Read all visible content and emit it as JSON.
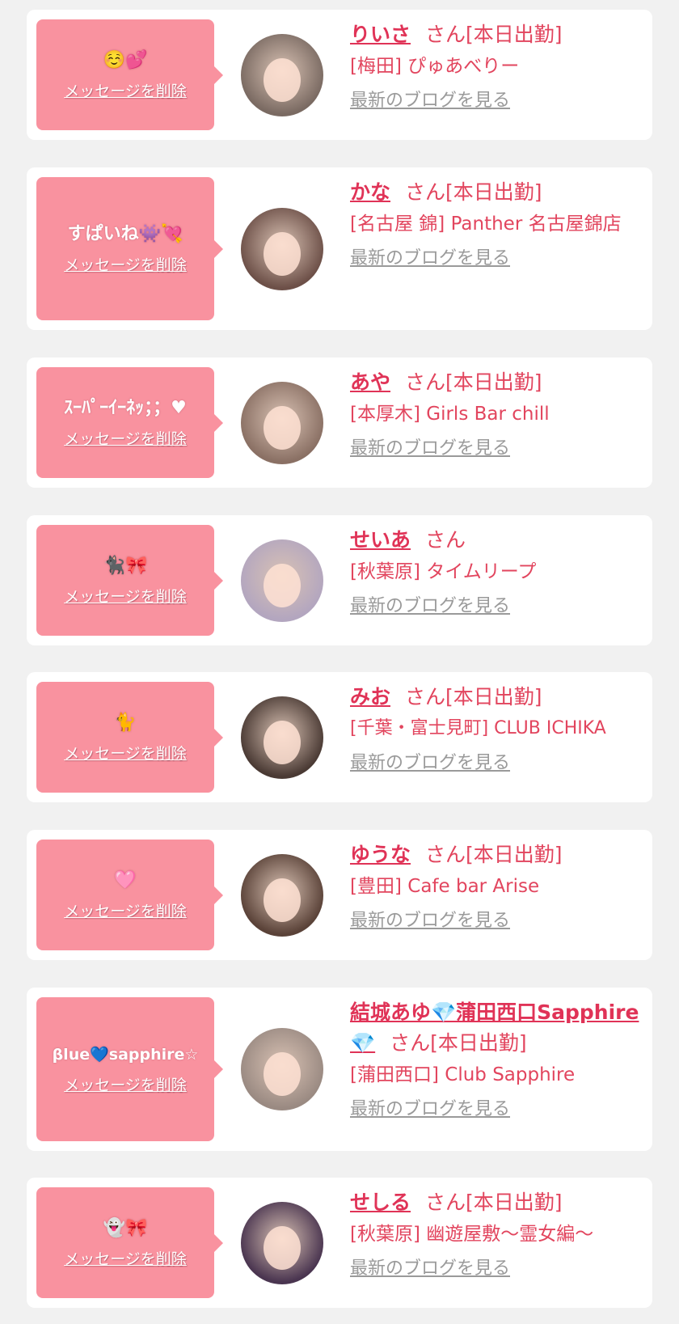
{
  "delete_label": "メッセージを削除",
  "blog_label": "最新のブログを見る",
  "san_suffix": "さん",
  "colors": {
    "accent": "#e03357",
    "bubble": "#f9929f",
    "background": "#f1f1f1"
  },
  "items": [
    {
      "message": "☺️💕",
      "name": "りいさ",
      "status": "さん[本日出勤]",
      "shop": "[梅田] ぴゅあべりー",
      "avatar_color": "#7a6a62"
    },
    {
      "message": "すぱいね👾💘",
      "name": "かな",
      "status": "さん[本日出勤]",
      "shop": "[名古屋 錦] Panther 名古屋錦店",
      "avatar_color": "#6d5048"
    },
    {
      "message": "ｽｰﾊﾟｰｲｰﾈｯ；；♥",
      "name": "あや",
      "status": "さん[本日出勤]",
      "shop": "[本厚木] Girls Bar chill",
      "avatar_color": "#8a7064"
    },
    {
      "message": "🐈‍⬛🎀",
      "name": "せいあ",
      "status": "さん",
      "shop": "[秋葉原] タイムリープ",
      "avatar_color": "#b3a6bf"
    },
    {
      "message": "🐈",
      "name": "みお",
      "status": "さん[本日出勤]",
      "shop": "[千葉・富士見町] CLUB ICHIKA",
      "avatar_color": "#4a3a34"
    },
    {
      "message": "🩷",
      "name": "ゆうな",
      "status": "さん[本日出勤]",
      "shop": "[豊田] Cafe bar Arise",
      "avatar_color": "#5a4238"
    },
    {
      "message": "βlue💙sapphire☆",
      "name": "結城あゆ💎蒲田西口Sapphire💎",
      "status": "さん[本日出勤]",
      "shop": "[蒲田西口] Club Sapphire",
      "avatar_color": "#9a8a82"
    },
    {
      "message": "👻🎀",
      "name": "せしる",
      "status": "さん[本日出勤]",
      "shop": "[秋葉原] 幽遊屋敷〜霊女編〜",
      "avatar_color": "#4a3550"
    }
  ]
}
